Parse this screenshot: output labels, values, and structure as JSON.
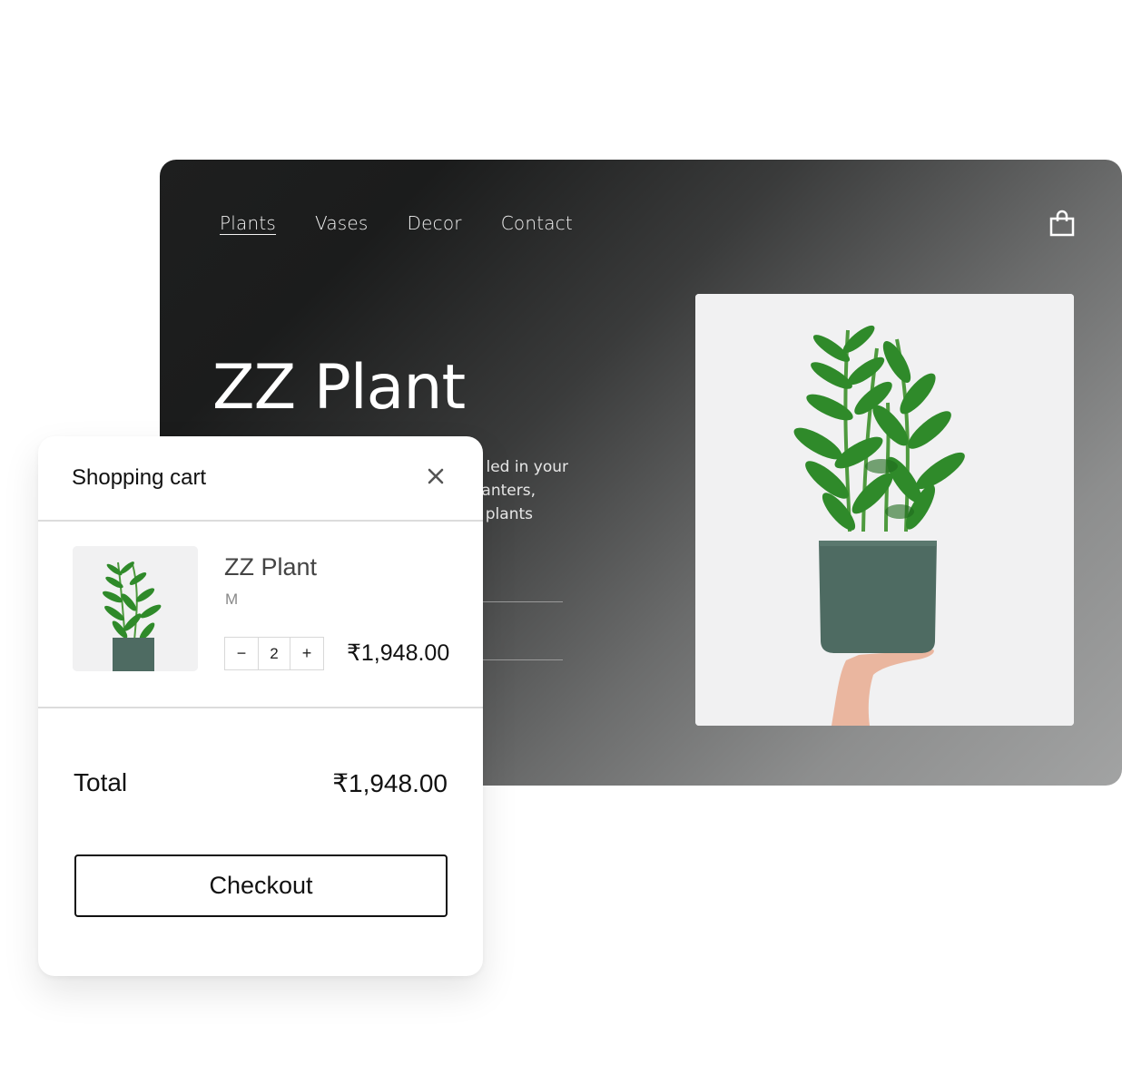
{
  "site": {
    "nav": [
      {
        "label": "Plants",
        "active": true
      },
      {
        "label": "Vases",
        "active": false
      },
      {
        "label": "Decor",
        "active": false
      },
      {
        "label": "Contact",
        "active": false
      }
    ],
    "cart_icon": "shopping-bag-icon",
    "hero": {
      "title": "ZZ Plant",
      "description_visible": [
        "led in your",
        "anters,",
        "plants"
      ],
      "image": "zz-plant-in-green-pot-held-by-hand"
    },
    "colors": {
      "background_dark": "#1b1c1c",
      "background_light": "#a2a3a3",
      "pot_green": "#4e6b62",
      "leaf_green": "#2f8a2a"
    }
  },
  "cart": {
    "title": "Shopping cart",
    "close_icon": "close-icon",
    "items": [
      {
        "name": "ZZ Plant",
        "variant": "M",
        "quantity": "2",
        "decrement": "−",
        "increment": "+",
        "price": "₹1,948.00",
        "image": "zz-plant-thumbnail"
      }
    ],
    "total_label": "Total",
    "total_value": "₹1,948.00",
    "checkout_label": "Checkout"
  }
}
